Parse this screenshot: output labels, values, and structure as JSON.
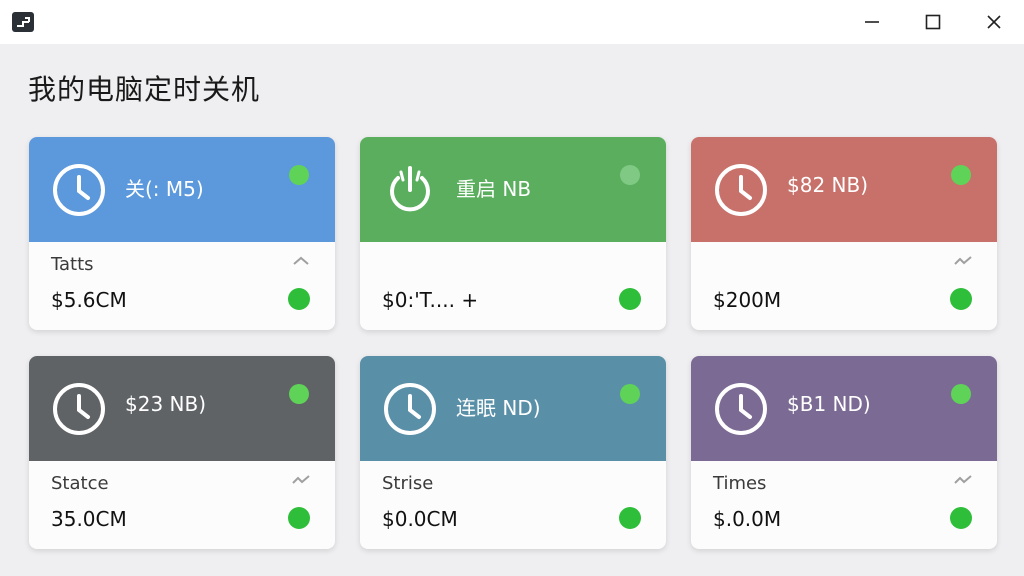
{
  "window": {
    "minimize_icon": "minimize-icon",
    "maximize_icon": "maximize-icon",
    "close_icon": "close-icon"
  },
  "page": {
    "title": "我的电脑定时关机"
  },
  "cards": [
    {
      "header_label": "关(: M5)",
      "header_color": "#5b98dc",
      "header_icon": "clock-icon",
      "body_label": "Tatts",
      "body_value": "$5.6CM",
      "trend_icon": "chevron-up-icon"
    },
    {
      "header_label": "重启 NB",
      "header_color": "#5aae5e",
      "header_icon": "power-icon",
      "body_label": "",
      "body_value": "$0:'T.... +",
      "trend_icon": ""
    },
    {
      "header_label": "$82 NB)",
      "header_color": "#c8716a",
      "header_icon": "clock-icon",
      "body_label": "",
      "body_value": "$200M",
      "trend_icon": "trend-icon"
    },
    {
      "header_label": "$23 NB)",
      "header_color": "#5f6366",
      "header_icon": "clock-icon",
      "body_label": "Statce",
      "body_value": "35.0CM",
      "trend_icon": "trend-icon"
    },
    {
      "header_label": "连眠 ND)",
      "header_color": "#5a8fa8",
      "header_icon": "clock-icon",
      "body_label": "Strise",
      "body_value": "$0.0CM",
      "trend_icon": ""
    },
    {
      "header_label": "$B1 ND)",
      "header_color": "#7b6a94",
      "header_icon": "clock-icon",
      "body_label": "Times",
      "body_value": "$.0.0M",
      "trend_icon": "trend-icon"
    }
  ]
}
